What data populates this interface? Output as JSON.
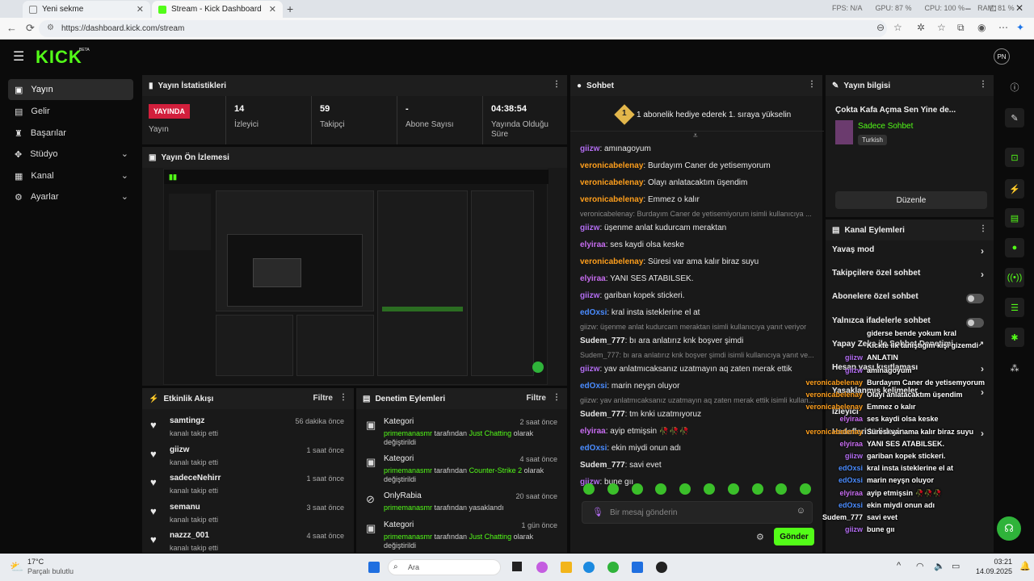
{
  "browser": {
    "tabs": [
      {
        "title": "Yeni sekme"
      },
      {
        "title": "Stream - Kick Dashboard"
      }
    ],
    "url": "https://dashboard.kick.com/stream",
    "hud": {
      "fps": "FPS: N/A",
      "gpu": "GPU: 87 %",
      "cpu": "CPU: 100 %",
      "ram": "RAM: 81 %"
    }
  },
  "app": {
    "logo": "KICK",
    "logo_tag": "BETA",
    "avatar_text": "PN"
  },
  "sidebar": {
    "items": [
      {
        "label": "Yayın",
        "icon": "video-icon"
      },
      {
        "label": "Gelir",
        "icon": "money-icon"
      },
      {
        "label": "Başarılar",
        "icon": "trophy-icon"
      },
      {
        "label": "Stüdyo",
        "icon": "studio-icon"
      },
      {
        "label": "Kanal",
        "icon": "channel-icon"
      },
      {
        "label": "Ayarlar",
        "icon": "gear-icon"
      }
    ]
  },
  "stats": {
    "title": "Yayın İstatistikleri",
    "live_badge": "YAYINDA",
    "items": [
      {
        "value": "",
        "label": "Yayın"
      },
      {
        "value": "14",
        "label": "İzleyici"
      },
      {
        "value": "59",
        "label": "Takipçi"
      },
      {
        "value": "-",
        "label": "Abone Sayısı"
      },
      {
        "value": "04:38:54",
        "label": "Yayında Olduğu Süre"
      }
    ]
  },
  "preview": {
    "title": "Yayın Ön İzlemesi"
  },
  "activity": {
    "title": "Etkinlik Akışı",
    "filter": "Filtre",
    "rows": [
      {
        "name": "samtingz",
        "sub": "kanalı takip etti",
        "time": "56 dakika önce"
      },
      {
        "name": "giizw",
        "sub": "kanalı takip etti",
        "time": "1 saat önce"
      },
      {
        "name": "sadeceNehirr",
        "sub": "kanalı takip etti",
        "time": "1 saat önce"
      },
      {
        "name": "semanu",
        "sub": "kanalı takip etti",
        "time": "3 saat önce"
      },
      {
        "name": "nazzz_001",
        "sub": "kanalı takip etti",
        "time": "4 saat önce"
      }
    ]
  },
  "moderation": {
    "title": "Denetim Eylemleri",
    "filter": "Filtre",
    "rows": [
      {
        "name": "Kategori",
        "user": "primemanasmr",
        "mid": " tarafından ",
        "target": "Just Chatting",
        "tail": " olarak değiştirildi",
        "time": "2 saat önce"
      },
      {
        "name": "Kategori",
        "user": "primemanasmr",
        "mid": " tarafından ",
        "target": "Counter-Strike 2",
        "tail": " olarak değiştirildi",
        "time": "4 saat önce"
      },
      {
        "name": "OnlyRabia",
        "user": "primemanasmr",
        "mid": " tarafından yasaklandı",
        "target": "",
        "tail": "",
        "time": "20 saat önce"
      },
      {
        "name": "Kategori",
        "user": "primemanasmr",
        "mid": " tarafından ",
        "target": "Just Chatting",
        "tail": " olarak değiştirildi",
        "time": "1 gün önce"
      }
    ]
  },
  "chat": {
    "title": "Sohbet",
    "gift_banner": "1 abonelik hediye ederek 1. sıraya yükselin",
    "gift_count": "1",
    "lines": [
      {
        "user": "giizw",
        "color": "#b36df2",
        "text": "amınagoyum"
      },
      {
        "user": "veronicabelenay",
        "color": "#ff9f1c",
        "text": "Burdayım Caner de yetisemyorum"
      },
      {
        "user": "veronicabelenay",
        "color": "#ff9f1c",
        "text": "Olayı anlatacaktım üşendim"
      },
      {
        "user": "veronicabelenay",
        "color": "#ff9f1c",
        "text": "Emmez o kalır"
      },
      {
        "reply": "veronicabelenay: Burdayım Caner de yetisemiyorum isimli kullanıcıya ..."
      },
      {
        "user": "giizw",
        "color": "#b36df2",
        "text": "üşenme anlat kudurcam meraktan"
      },
      {
        "user": "elyiraa",
        "color": "#c76cf0",
        "text": "ses kaydi olsa keske"
      },
      {
        "user": "veronicabelenay",
        "color": "#ff9f1c",
        "text": "Süresi var ama kalır biraz suyu"
      },
      {
        "user": "elyiraa",
        "color": "#c76cf0",
        "text": "YANI SES ATABILSEK."
      },
      {
        "user": "giizw",
        "color": "#b36df2",
        "text": "gariban kopek stickeri."
      },
      {
        "user": "edOxsi",
        "color": "#4a8cff",
        "text": "kral insta isteklerine el at"
      },
      {
        "reply": "giizw: üşenme anlat kudurcam meraktan isimli kullanıcıya yanıt veriyor"
      },
      {
        "user": "Sudem_777",
        "color": "#e8e8e8",
        "text": "bı ara anlatırız knk boşver şimdi"
      },
      {
        "reply": "Sudem_777: bı ara anlatırız knk boşver şimdi isimli kullanıcıya yanıt ve..."
      },
      {
        "user": "giizw",
        "color": "#b36df2",
        "text": "yav anlatmıcaksanız uzatmayın aq zaten merak ettik"
      },
      {
        "user": "edOxsi",
        "color": "#4a8cff",
        "text": "marin neyşn oluyor"
      },
      {
        "reply": "giizw: yav anlatmıcaksanız uzatmayın aq zaten merak ettik isimli kullan..."
      },
      {
        "user": "Sudem_777",
        "color": "#e8e8e8",
        "text": "tm knki uzatmıyoruz"
      },
      {
        "user": "elyiraa",
        "color": "#c76cf0",
        "text": "ayip etmişsin 🥀🥀🥀"
      },
      {
        "user": "edOxsi",
        "color": "#4a8cff",
        "text": "ekin miydi onun adı"
      },
      {
        "user": "Sudem_777",
        "color": "#e8e8e8",
        "text": "savi evet"
      },
      {
        "user": "giizw",
        "color": "#b36df2",
        "text": "bune gıı"
      }
    ],
    "input_placeholder": "Bir mesaj gönderin",
    "send_label": "Gönder"
  },
  "stream_info": {
    "title": "Yayın bilgisi",
    "stream_title": "Çokta Kafa Açma Sen Yine de...",
    "category": "Sadece Sohbet",
    "tag": "Turkish",
    "edit_label": "Düzenle"
  },
  "channel_actions": {
    "title": "Kanal Eylemleri",
    "items": [
      {
        "label": "Yavaş mod",
        "kind": "arrow"
      },
      {
        "label": "Takipçilere özel sohbet",
        "kind": "arrow"
      },
      {
        "label": "Abonelere özel sohbet",
        "kind": "toggle"
      },
      {
        "label": "Yalnızca ifadelerle sohbet",
        "kind": "toggle"
      },
      {
        "label": "Yapay Zeka ile Sohbet Denetimi",
        "kind": "ext"
      },
      {
        "label": "Hesap yaşı kısıtlaması",
        "kind": "arrow"
      },
      {
        "label": "Yasaklanmış kelimeler",
        "kind": "arrow"
      },
      {
        "label": "İzleyici",
        "kind": "none"
      },
      {
        "label": "Hedefleri belirleyin",
        "kind": "arrow"
      }
    ]
  },
  "overlay_chat": [
    {
      "user": "",
      "color": "#ffffff",
      "text": "giderse bende yokum kral"
    },
    {
      "user": "",
      "color": "#ffffff",
      "text": "Kickte ilk tanıştığım kişi gizemdi"
    },
    {
      "user": "giizw",
      "color": "#b36df2",
      "text": "ANLATIN"
    },
    {
      "user": "giizw",
      "color": "#b36df2",
      "text": "amınagoyum"
    },
    {
      "user": "veronicabelenay",
      "color": "#ff9f1c",
      "text": "Burdayım Caner de yetisemyorum"
    },
    {
      "user": "veronicabelenay",
      "color": "#ff9f1c",
      "text": "Olayı anlatacaktım üşendim"
    },
    {
      "user": "veronicabelenay",
      "color": "#ff9f1c",
      "text": "Emmez o kalır"
    },
    {
      "user": "elyiraa",
      "color": "#c76cf0",
      "text": "ses kaydi olsa keske"
    },
    {
      "user": "veronicabelenay",
      "color": "#ff9f1c",
      "text": "Süresi var ama kalır biraz suyu"
    },
    {
      "user": "elyiraa",
      "color": "#c76cf0",
      "text": "YANI SES ATABILSEK."
    },
    {
      "user": "giizw",
      "color": "#b36df2",
      "text": "gariban kopek stickeri."
    },
    {
      "user": "edOxsi",
      "color": "#4a8cff",
      "text": "kral insta isteklerine el at"
    },
    {
      "user": "edOxsi",
      "color": "#4a8cff",
      "text": "marin neyşn oluyor"
    },
    {
      "user": "elyiraa",
      "color": "#c76cf0",
      "text": "ayip etmişsin 🥀🥀🥀"
    },
    {
      "user": "edOxsi",
      "color": "#4a8cff",
      "text": "ekin miydi onun adı"
    },
    {
      "user": "Sudem_777",
      "color": "#ffffff",
      "text": "savi evet"
    },
    {
      "user": "giizw",
      "color": "#b36df2",
      "text": "bune gıı"
    }
  ],
  "taskbar": {
    "weather_temp": "17°C",
    "weather_desc": "Parçalı bulutlu",
    "search": "Ara",
    "time": "03:21",
    "date": "14.09.2025"
  },
  "colors": {
    "accent": "#53fc18",
    "live": "#d21f3c",
    "panel": "#191919"
  }
}
